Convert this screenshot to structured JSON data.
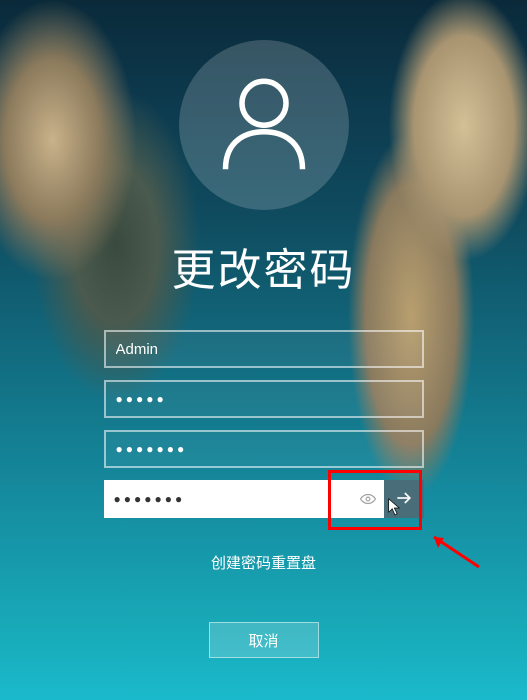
{
  "title": "更改密码",
  "username_field": {
    "value": "Admin"
  },
  "old_password_field": {
    "masked_value": "●●●●●"
  },
  "new_password_field": {
    "masked_value": "●●●●●●●"
  },
  "confirm_password_field": {
    "masked_value": "●●●●●●●"
  },
  "reset_disk_link": "创建密码重置盘",
  "cancel_button": "取消",
  "icons": {
    "user": "user-icon",
    "reveal": "eye-icon",
    "submit": "arrow-right-icon"
  },
  "annotation": {
    "highlight": "red-box-on-submit",
    "arrow": "red-arrow-pointing-to-submit"
  }
}
